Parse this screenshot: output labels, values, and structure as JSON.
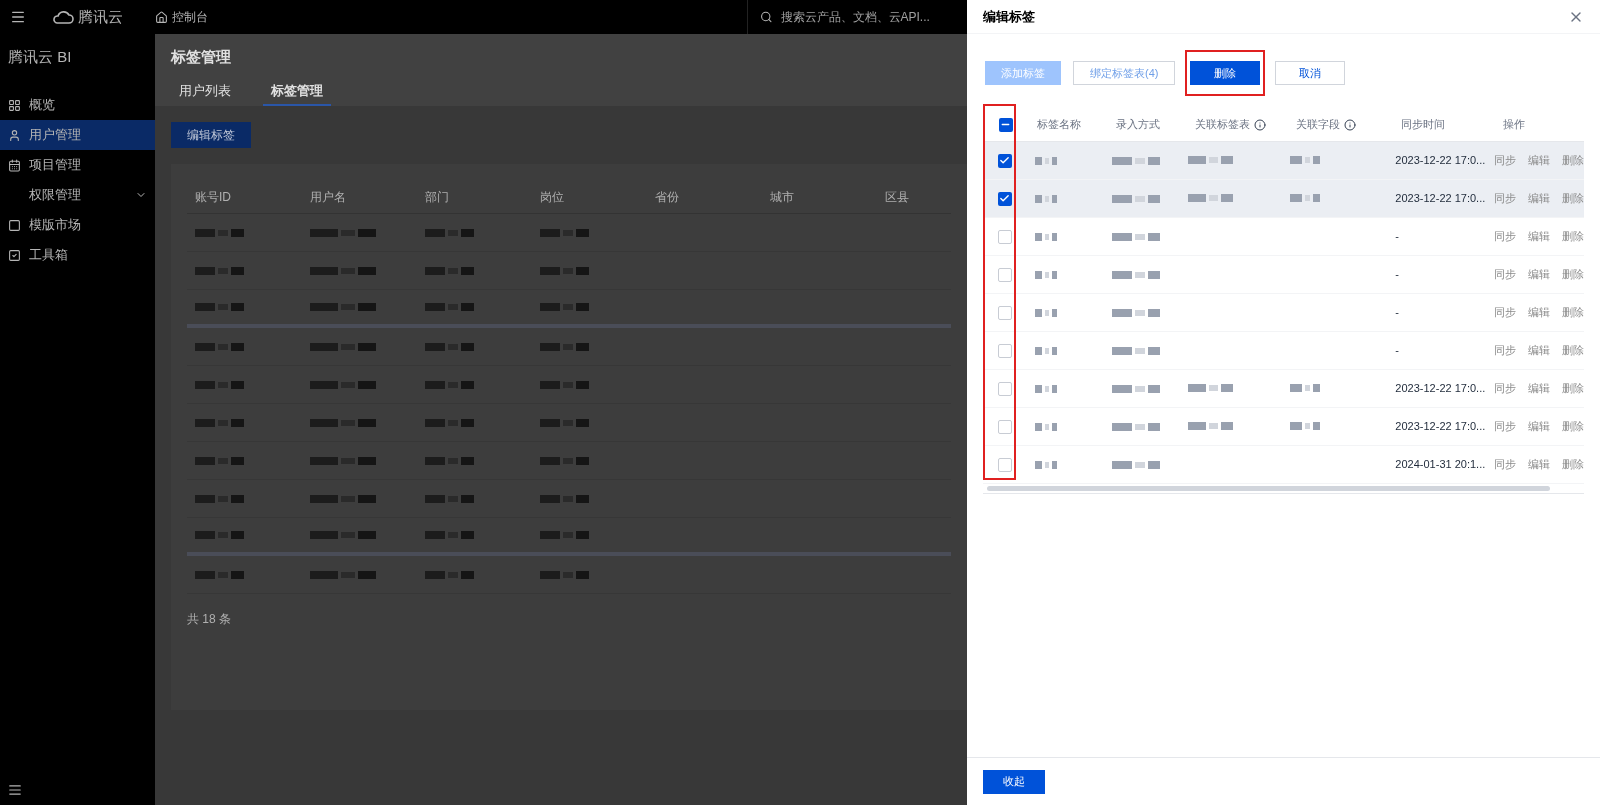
{
  "topbar": {
    "logo_text": "腾讯云",
    "console": "控制台",
    "search": {
      "placeholder": "搜索云产品、文档、云API..."
    }
  },
  "sidebar": {
    "title": "腾讯云 BI",
    "items": [
      {
        "label": "概览",
        "selected": false
      },
      {
        "label": "用户管理",
        "selected": true
      },
      {
        "label": "项目管理",
        "selected": false
      },
      {
        "label": "权限管理",
        "selected": false,
        "expanded": false
      },
      {
        "label": "模版市场",
        "selected": false
      },
      {
        "label": "工具箱",
        "selected": false
      }
    ]
  },
  "page": {
    "title": "标签管理",
    "tabs": [
      {
        "label": "用户列表",
        "selected": false
      },
      {
        "label": "标签管理",
        "selected": true
      }
    ],
    "edit_button": "编辑标签",
    "table": {
      "columns": [
        "账号ID",
        "用户名",
        "部门",
        "岗位",
        "省份",
        "城市",
        "区县"
      ],
      "footer": "共 18 条"
    }
  },
  "drawer": {
    "title": "编辑标签",
    "buttons": [
      {
        "label": "添加标签",
        "kind": "primary",
        "disabled": true,
        "highlighted": false
      },
      {
        "label": "绑定标签表(4)",
        "kind": "default",
        "disabled": true,
        "highlighted": false
      },
      {
        "label": "删除",
        "kind": "primary",
        "disabled": false,
        "highlighted": true
      },
      {
        "label": "取消",
        "kind": "default",
        "disabled": false,
        "highlighted": false
      }
    ],
    "table": {
      "select_all": {
        "indeterminate": true
      },
      "checkbox_column_highlighted": true,
      "columns": [
        {
          "label": "标签名称",
          "info": false
        },
        {
          "label": "录入方式",
          "info": false
        },
        {
          "label": "关联标签表",
          "info": true
        },
        {
          "label": "关联字段",
          "info": true
        },
        {
          "label": "同步时间",
          "info": false
        },
        {
          "label": "操作",
          "info": false
        }
      ],
      "rows": [
        {
          "checked": true,
          "linked": true,
          "sync_time": "2023-12-22 17:0...",
          "actions": [
            "同步",
            "编辑",
            "删除"
          ]
        },
        {
          "checked": true,
          "linked": true,
          "sync_time": "2023-12-22 17:0...",
          "actions": [
            "同步",
            "编辑",
            "删除"
          ]
        },
        {
          "checked": false,
          "linked": false,
          "sync_time": "-",
          "actions": [
            "同步",
            "编辑",
            "删除"
          ]
        },
        {
          "checked": false,
          "linked": false,
          "sync_time": "-",
          "actions": [
            "同步",
            "编辑",
            "删除"
          ]
        },
        {
          "checked": false,
          "linked": false,
          "sync_time": "-",
          "actions": [
            "同步",
            "编辑",
            "删除"
          ]
        },
        {
          "checked": false,
          "linked": false,
          "sync_time": "-",
          "actions": [
            "同步",
            "编辑",
            "删除"
          ]
        },
        {
          "checked": false,
          "linked": true,
          "sync_time": "2023-12-22 17:0...",
          "actions": [
            "同步",
            "编辑",
            "删除"
          ]
        },
        {
          "checked": false,
          "linked": true,
          "sync_time": "2023-12-22 17:0...",
          "actions": [
            "同步",
            "编辑",
            "删除"
          ]
        },
        {
          "checked": false,
          "linked": false,
          "sync_time": "2024-01-31 20:1...",
          "actions": [
            "同步",
            "编辑",
            "删除"
          ]
        }
      ]
    },
    "collapse_button": "收起"
  }
}
